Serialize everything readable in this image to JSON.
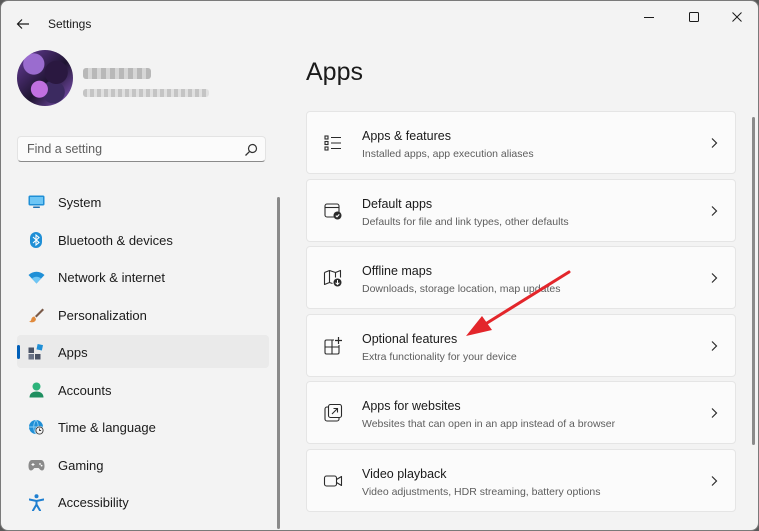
{
  "window": {
    "title": "Settings",
    "back_icon": "back-arrow-icon",
    "controls": [
      "minimize-icon",
      "maximize-icon",
      "close-icon"
    ]
  },
  "search": {
    "placeholder": "Find a setting",
    "value": "",
    "icon": "search-icon"
  },
  "sidebar": {
    "items": [
      {
        "label": "System",
        "icon": "monitor-icon",
        "color": "#1f8fd6"
      },
      {
        "label": "Bluetooth & devices",
        "icon": "bluetooth-icon",
        "color": "#1f8fd6"
      },
      {
        "label": "Network & internet",
        "icon": "wifi-icon",
        "color": "#1f8fd6"
      },
      {
        "label": "Personalization",
        "icon": "brush-icon",
        "color": "#e08a3c"
      },
      {
        "label": "Apps",
        "icon": "apps-icon",
        "color": "#5a6170",
        "selected": true
      },
      {
        "label": "Accounts",
        "icon": "person-icon",
        "color": "#2cb37a"
      },
      {
        "label": "Time & language",
        "icon": "globe-clock-icon",
        "color": "#1f8fd6"
      },
      {
        "label": "Gaming",
        "icon": "gamepad-icon",
        "color": "#8a8a8a"
      },
      {
        "label": "Accessibility",
        "icon": "accessibility-icon",
        "color": "#1f7fd0"
      }
    ]
  },
  "main": {
    "title": "Apps",
    "cards": [
      {
        "title": "Apps & features",
        "subtitle": "Installed apps, app execution aliases",
        "icon": "list-icon"
      },
      {
        "title": "Default apps",
        "subtitle": "Defaults for file and link types, other defaults",
        "icon": "default-apps-icon"
      },
      {
        "title": "Offline maps",
        "subtitle": "Downloads, storage location, map updates",
        "icon": "map-icon"
      },
      {
        "title": "Optional features",
        "subtitle": "Extra functionality for your device",
        "icon": "optional-features-icon"
      },
      {
        "title": "Apps for websites",
        "subtitle": "Websites that can open in an app instead of a browser",
        "icon": "open-link-icon"
      },
      {
        "title": "Video playback",
        "subtitle": "Video adjustments, HDR streaming, battery options",
        "icon": "video-icon"
      }
    ]
  },
  "annotation": {
    "color": "#e3262b",
    "points_to": "Optional features"
  }
}
